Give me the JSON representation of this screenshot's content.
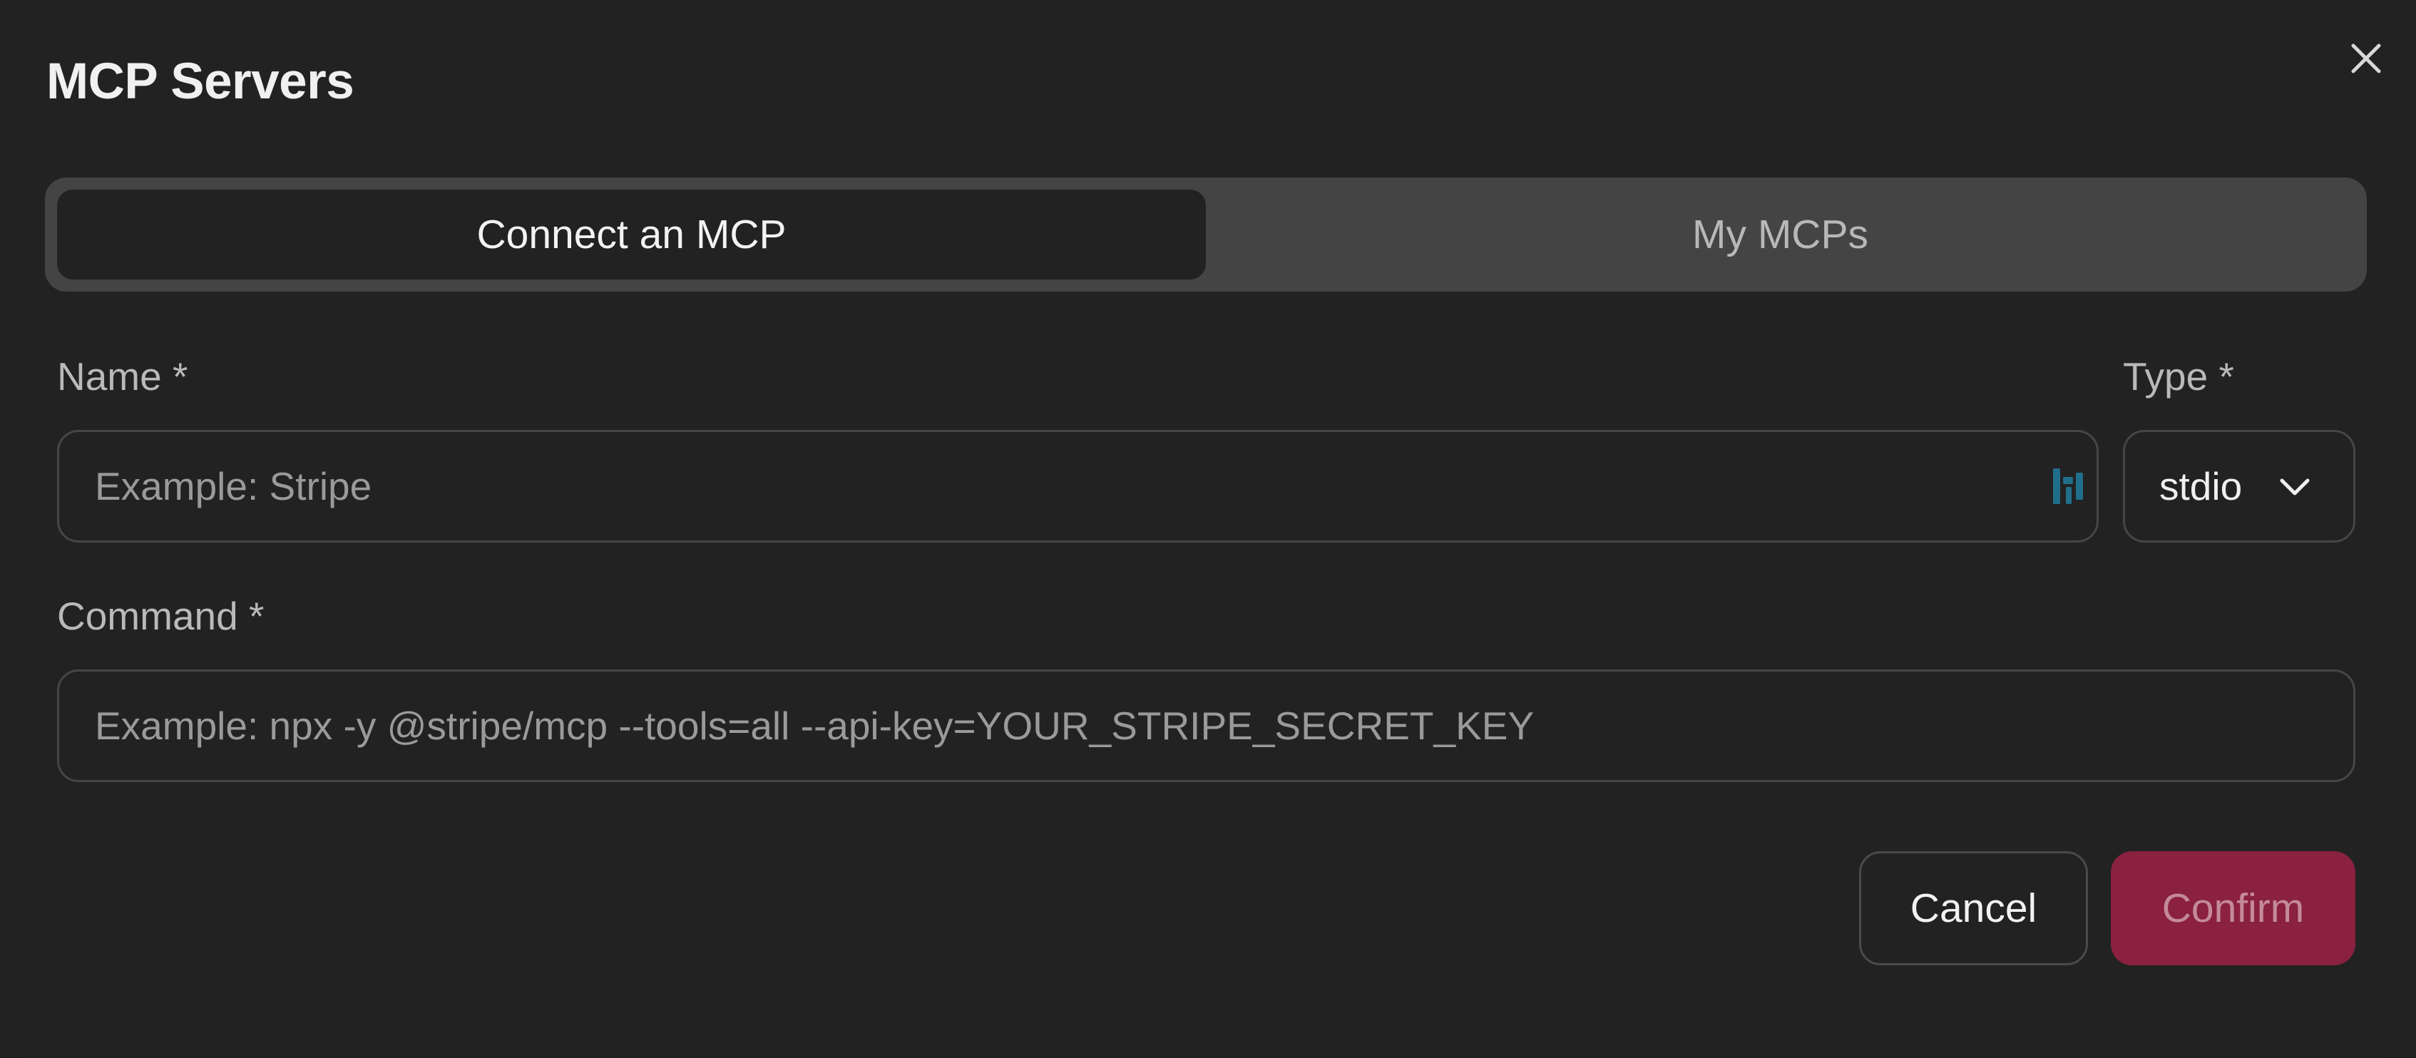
{
  "dialog": {
    "title": "MCP Servers",
    "close_icon": "close-icon"
  },
  "tabs": [
    {
      "label": "Connect an MCP",
      "active": true
    },
    {
      "label": "My MCPs",
      "active": false
    }
  ],
  "form": {
    "name": {
      "label": "Name *",
      "value": "",
      "placeholder": "Example: Stripe",
      "extension_icon": "password-manager-icon"
    },
    "type": {
      "label": "Type *",
      "selected": "stdio",
      "icon": "chevron-down-icon"
    },
    "command": {
      "label": "Command *",
      "value": "",
      "placeholder": "Example: npx -y @stripe/mcp --tools=all --api-key=YOUR_STRIPE_SECRET_KEY"
    }
  },
  "actions": {
    "cancel_label": "Cancel",
    "confirm_label": "Confirm"
  },
  "colors": {
    "background": "#222222",
    "tab_track": "#444444",
    "confirm_bg": "#8a2141",
    "confirm_text": "#c48a9a",
    "border": "#464646",
    "extension_icon": "#1f6f8b"
  }
}
